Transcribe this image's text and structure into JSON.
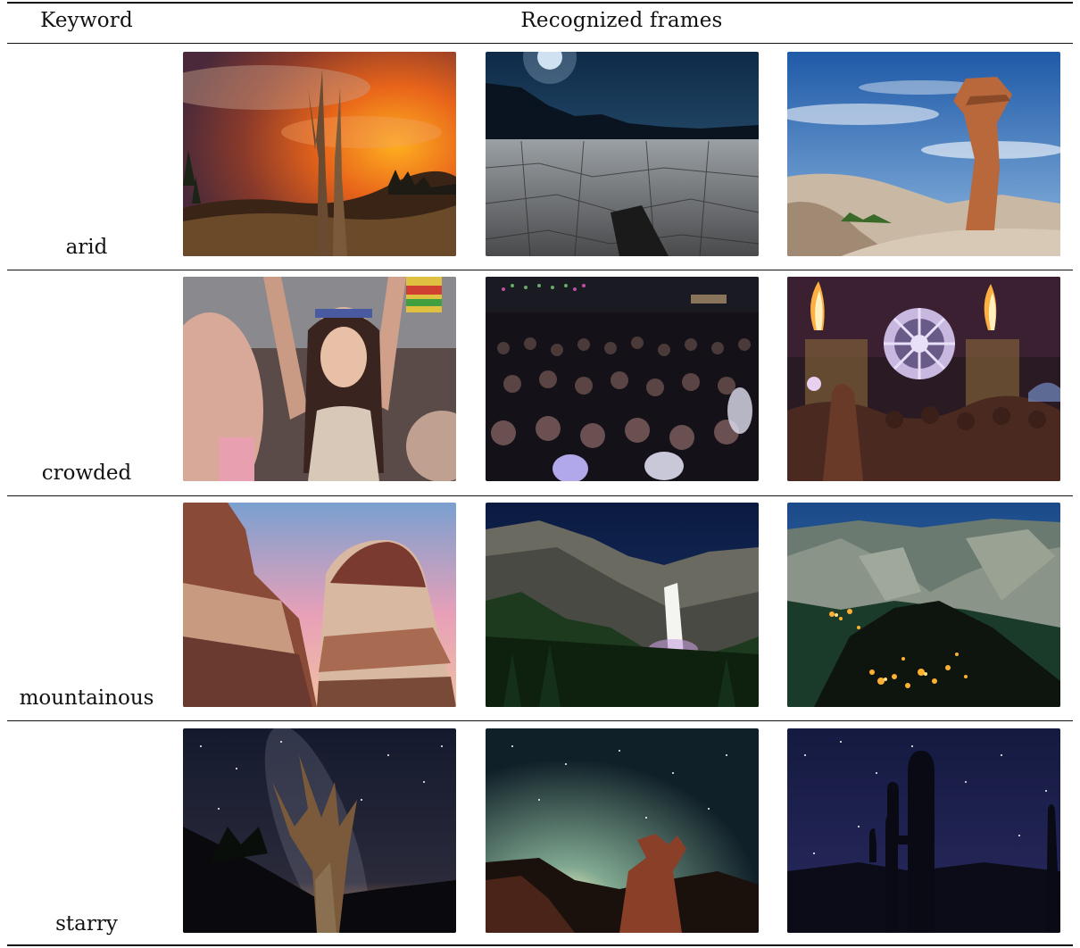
{
  "table": {
    "header": {
      "keyword": "Keyword",
      "frames": "Recognized frames"
    },
    "rows": [
      {
        "keyword": "arid",
        "frames": [
          {
            "scene": "dead tree under orange sunset clouds",
            "icon": "sunset-tree-icon"
          },
          {
            "scene": "cracked desert playa at night",
            "icon": "cracked-desert-icon"
          },
          {
            "scene": "sandstone hoodoo under blue sky",
            "icon": "rock-pillar-icon"
          }
        ]
      },
      {
        "keyword": "crowded",
        "frames": [
          {
            "scene": "festival crowd close-up",
            "icon": "crowd-closeup-icon"
          },
          {
            "scene": "dense concert crowd at night",
            "icon": "concert-crowd-icon"
          },
          {
            "scene": "stage with flame towers",
            "icon": "stage-flames-icon"
          }
        ]
      },
      {
        "keyword": "mountainous",
        "frames": [
          {
            "scene": "layered red rock cliffs at dusk",
            "icon": "red-rocks-icon"
          },
          {
            "scene": "waterfall in granite valley",
            "icon": "waterfall-icon"
          },
          {
            "scene": "valley with wildfire glow",
            "icon": "valley-fire-icon"
          }
        ]
      },
      {
        "keyword": "starry",
        "frames": [
          {
            "scene": "twisted tree under milky way",
            "icon": "milky-way-tree-icon"
          },
          {
            "scene": "rock formation under stars",
            "icon": "star-rock-icon"
          },
          {
            "scene": "saguaro cactus under stars",
            "icon": "cactus-stars-icon"
          }
        ]
      }
    ]
  }
}
